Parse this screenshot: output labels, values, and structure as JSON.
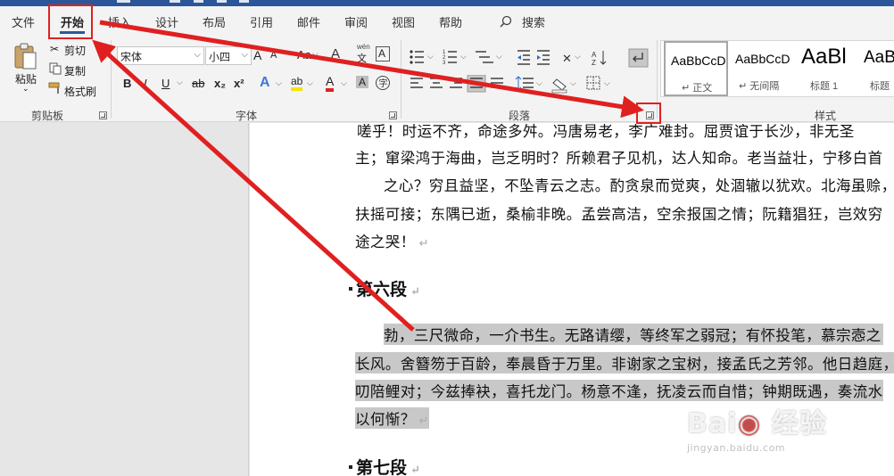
{
  "tabs": [
    "文件",
    "开始",
    "插入",
    "设计",
    "布局",
    "引用",
    "邮件",
    "审阅",
    "视图",
    "帮助",
    "搜索"
  ],
  "clipboard": {
    "paste": "粘贴",
    "cut": "剪切",
    "copy": "复制",
    "format_painter": "格式刷",
    "group": "剪贴板"
  },
  "font": {
    "name": "宋体",
    "size": "小四",
    "group": "字体",
    "pinyin": "wén",
    "bold": "B",
    "italic": "I",
    "underline": "U",
    "strike": "ab",
    "sub": "x₂",
    "sup": "x²",
    "aa": "Aa",
    "grow": "A",
    "shrink": "A",
    "effects": "A",
    "highlight": "ab",
    "color": "A",
    "shade": "A",
    "border_a": "A"
  },
  "paragraph": {
    "group": "段落"
  },
  "styles": {
    "group": "样式",
    "items": [
      {
        "sample": "AaBbCcD",
        "name": "正文",
        "arrow": "↵"
      },
      {
        "sample": "AaBbCcD",
        "name": "无间隔",
        "arrow": "↵"
      },
      {
        "sample": "AaBl",
        "name": "标题 1"
      },
      {
        "sample": "AaB",
        "name": "标题"
      }
    ]
  },
  "document": {
    "lines": [
      {
        "text": "嗟乎！时运不齐，命途多舛。冯唐易老，李广难封。屈贾谊于长沙，非无圣",
        "highlight": false
      },
      {
        "text": "主；窜梁鸿于海曲，岂乏明时？所赖君子见机，达人知命。老当益壮，宁移白首",
        "highlight": false
      },
      {
        "text": "之心？穷且益坚，不坠青云之志。酌贪泉而觉爽，处涸辙以犹欢。北海虽赊，",
        "highlight": false
      },
      {
        "text": "扶摇可接；东隅已逝，桑榆非晚。孟尝高洁，空余报国之情；阮籍猖狂，岂效穷",
        "highlight": false
      },
      {
        "text": "途之哭！",
        "highlight": false
      }
    ],
    "heading6": "第六段",
    "para6": [
      {
        "text": "勃，三尺微命，一介书生。无路请缨，等终军之弱冠；有怀投笔，慕宗悫之"
      },
      {
        "text": "长风。舍簪笏于百龄，奉晨昏于万里。非谢家之宝树，接孟氏之芳邻。他日趋庭，"
      },
      {
        "text": "叨陪鲤对；今兹捧袂，喜托龙门。杨意不逢，抚凌云而自惜；钟期既遇，奏流水"
      },
      {
        "text": "以何惭？"
      }
    ],
    "heading7": "第七段",
    "para_mark": "↵"
  },
  "watermark": {
    "brand": "Bai",
    "brand2": "经验",
    "url": "jingyan.baidu.com"
  }
}
